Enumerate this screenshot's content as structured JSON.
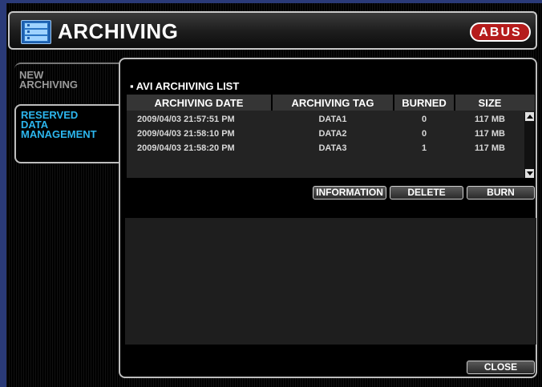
{
  "window": {
    "title": "ARCHIVING",
    "logo_text": "ABUS",
    "accent_color": "#2cb6ee",
    "brand_color": "#b51c1c"
  },
  "tabs": [
    {
      "label_line1": "NEW",
      "label_line2": "ARCHIVING",
      "label_line3": "",
      "active": false
    },
    {
      "label_line1": "RESERVED",
      "label_line2": "DATA",
      "label_line3": "MANAGEMENT",
      "active": true
    }
  ],
  "list": {
    "section_title": "▪ AVI ARCHIVING LIST",
    "columns": [
      "ARCHIVING DATE",
      "ARCHIVING TAG",
      "BURNED",
      "SIZE"
    ],
    "rows": [
      {
        "date": "2009/04/03 21:57:51 PM",
        "tag": "DATA1",
        "burned": "0",
        "size": "117 MB"
      },
      {
        "date": "2009/04/03 21:58:10 PM",
        "tag": "DATA2",
        "burned": "0",
        "size": "117 MB"
      },
      {
        "date": "2009/04/03 21:58:20 PM",
        "tag": "DATA3",
        "burned": "1",
        "size": "117 MB"
      }
    ]
  },
  "buttons": {
    "information": "INFORMATION",
    "delete": "DELETE",
    "burn": "BURN",
    "close": "CLOSE"
  },
  "icons": {
    "app": "archive-list-icon",
    "scroll_up": "scroll-up-arrow-icon",
    "scroll_down": "scroll-down-arrow-icon"
  }
}
